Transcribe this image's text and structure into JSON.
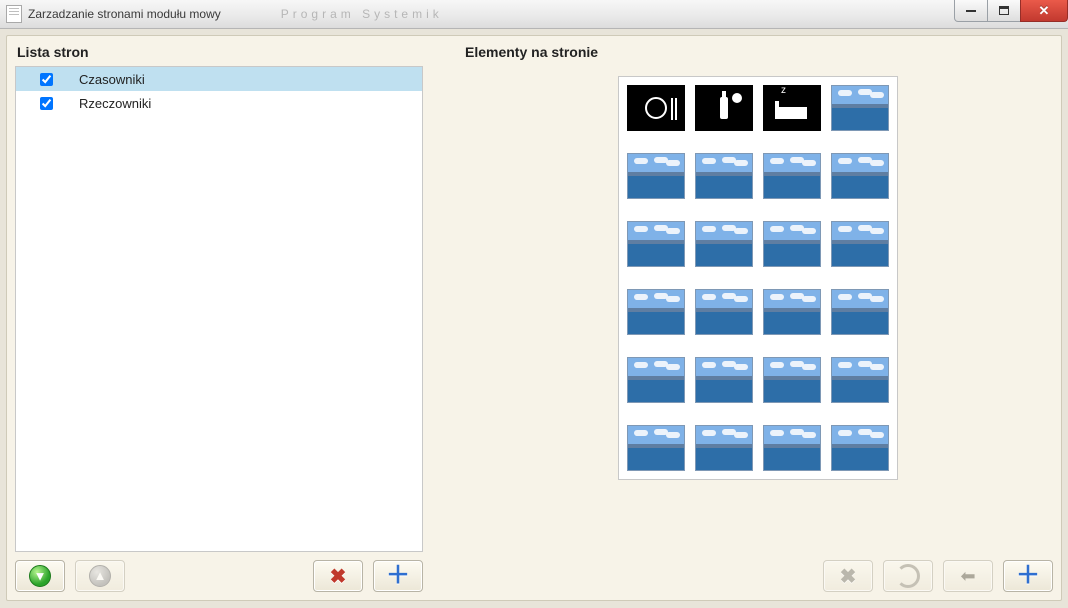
{
  "window": {
    "title": "Zarzadzanie stronami modułu mowy",
    "ghost_menu": "Program    Systemik"
  },
  "left": {
    "heading": "Lista stron",
    "items": [
      {
        "label": "Czasowniki",
        "checked": true,
        "selected": true
      },
      {
        "label": "Rzeczowniki",
        "checked": true,
        "selected": false
      }
    ]
  },
  "right": {
    "heading": "Elementy na stronie",
    "grid_cols": 4,
    "grid_rows": 6,
    "elements": [
      {
        "kind": "picto",
        "icon": "eat"
      },
      {
        "kind": "picto",
        "icon": "drink"
      },
      {
        "kind": "picto",
        "icon": "sleep"
      },
      {
        "kind": "landscape"
      },
      {
        "kind": "landscape"
      },
      {
        "kind": "landscape"
      },
      {
        "kind": "landscape"
      },
      {
        "kind": "landscape"
      },
      {
        "kind": "landscape"
      },
      {
        "kind": "landscape"
      },
      {
        "kind": "landscape"
      },
      {
        "kind": "landscape"
      },
      {
        "kind": "landscape"
      },
      {
        "kind": "landscape"
      },
      {
        "kind": "landscape"
      },
      {
        "kind": "landscape"
      },
      {
        "kind": "landscape"
      },
      {
        "kind": "landscape"
      },
      {
        "kind": "landscape"
      },
      {
        "kind": "landscape"
      },
      {
        "kind": "landscape"
      },
      {
        "kind": "landscape"
      },
      {
        "kind": "landscape"
      },
      {
        "kind": "landscape"
      }
    ]
  },
  "left_toolbar": [
    {
      "id": "move-down",
      "enabled": true,
      "icon": "arrow-down-green"
    },
    {
      "id": "move-up",
      "enabled": false,
      "icon": "arrow-up-gray"
    },
    {
      "id": "spacer"
    },
    {
      "id": "delete-page",
      "enabled": true,
      "icon": "x-red"
    },
    {
      "id": "add-page",
      "enabled": true,
      "icon": "plus-blue"
    }
  ],
  "right_toolbar": [
    {
      "id": "delete-element",
      "enabled": false,
      "icon": "x-gray"
    },
    {
      "id": "refresh",
      "enabled": false,
      "icon": "refresh"
    },
    {
      "id": "back",
      "enabled": false,
      "icon": "back"
    },
    {
      "id": "add-element",
      "enabled": true,
      "icon": "plus-blue"
    }
  ]
}
